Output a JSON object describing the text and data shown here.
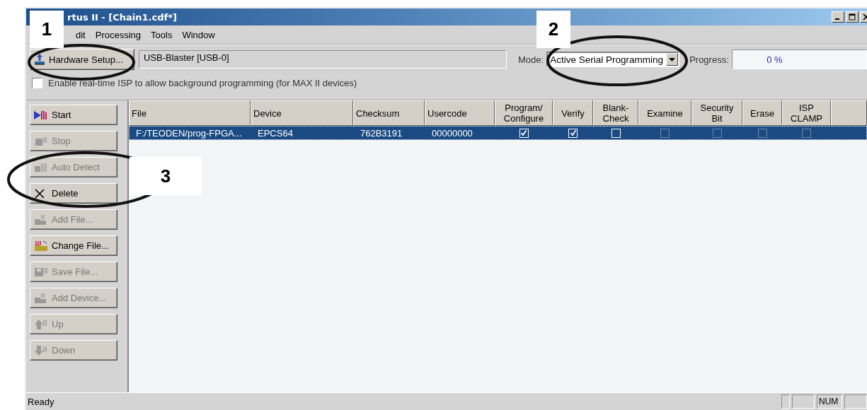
{
  "window": {
    "title": "rtus II - [Chain1.cdf*]"
  },
  "menu": [
    "dit",
    "Processing",
    "Tools",
    "Window"
  ],
  "toolbar": {
    "hardware_button": "Hardware Setup...",
    "hardware_value": "USB-Blaster [USB-0]",
    "mode_label": "Mode:",
    "mode_value": "Active Serial Programming",
    "progress_label": "Progress:",
    "progress_value": "0 %"
  },
  "isp_option": {
    "label": "Enable real-time ISP to allow background programming (for MAX II devices)",
    "checked": false
  },
  "buttons": [
    {
      "kind": "start",
      "label": "Start",
      "disabled": false
    },
    {
      "kind": "stop",
      "label": "Stop",
      "disabled": true
    },
    {
      "kind": "autodetect",
      "label": "Auto Detect",
      "disabled": true
    },
    {
      "kind": "delete",
      "label": "Delete",
      "disabled": false
    },
    {
      "kind": "addfile",
      "label": "Add File...",
      "disabled": true
    },
    {
      "kind": "changefile",
      "label": "Change File...",
      "disabled": false
    },
    {
      "kind": "savefile",
      "label": "Save File...",
      "disabled": true
    },
    {
      "kind": "adddevice",
      "label": "Add Device...",
      "disabled": true
    },
    {
      "kind": "up",
      "label": "Up",
      "disabled": true
    },
    {
      "kind": "down",
      "label": "Down",
      "disabled": true
    }
  ],
  "table": {
    "columns": [
      {
        "label": "File",
        "kind": "text"
      },
      {
        "label": "Device",
        "kind": "text"
      },
      {
        "label": "Checksum",
        "kind": "text"
      },
      {
        "label": "Usercode",
        "kind": "text"
      },
      {
        "label": "Program/\nConfigure",
        "kind": "check"
      },
      {
        "label": "Verify",
        "kind": "check"
      },
      {
        "label": "Blank-\nCheck",
        "kind": "check"
      },
      {
        "label": "Examine",
        "kind": "check"
      },
      {
        "label": "Security\nBit",
        "kind": "check"
      },
      {
        "label": "Erase",
        "kind": "check"
      },
      {
        "label": "ISP\nCLAMP",
        "kind": "check"
      }
    ],
    "rows": [
      {
        "selected": true,
        "cells": [
          {
            "text": "F:/TEODEN/prog-FPGA..."
          },
          {
            "text": "EPCS64"
          },
          {
            "text": "762B3191"
          },
          {
            "text": "00000000"
          },
          {
            "checked": true,
            "disabled": false
          },
          {
            "checked": true,
            "disabled": false
          },
          {
            "checked": false,
            "disabled": false
          },
          {
            "checked": false,
            "disabled": true
          },
          {
            "checked": false,
            "disabled": true
          },
          {
            "checked": false,
            "disabled": true
          },
          {
            "checked": false,
            "disabled": true
          }
        ]
      }
    ]
  },
  "status_bar": {
    "text": "Ready",
    "indicators": [
      "NUM"
    ]
  },
  "callouts": [
    {
      "label": "1"
    },
    {
      "label": "2"
    },
    {
      "label": "3"
    }
  ]
}
